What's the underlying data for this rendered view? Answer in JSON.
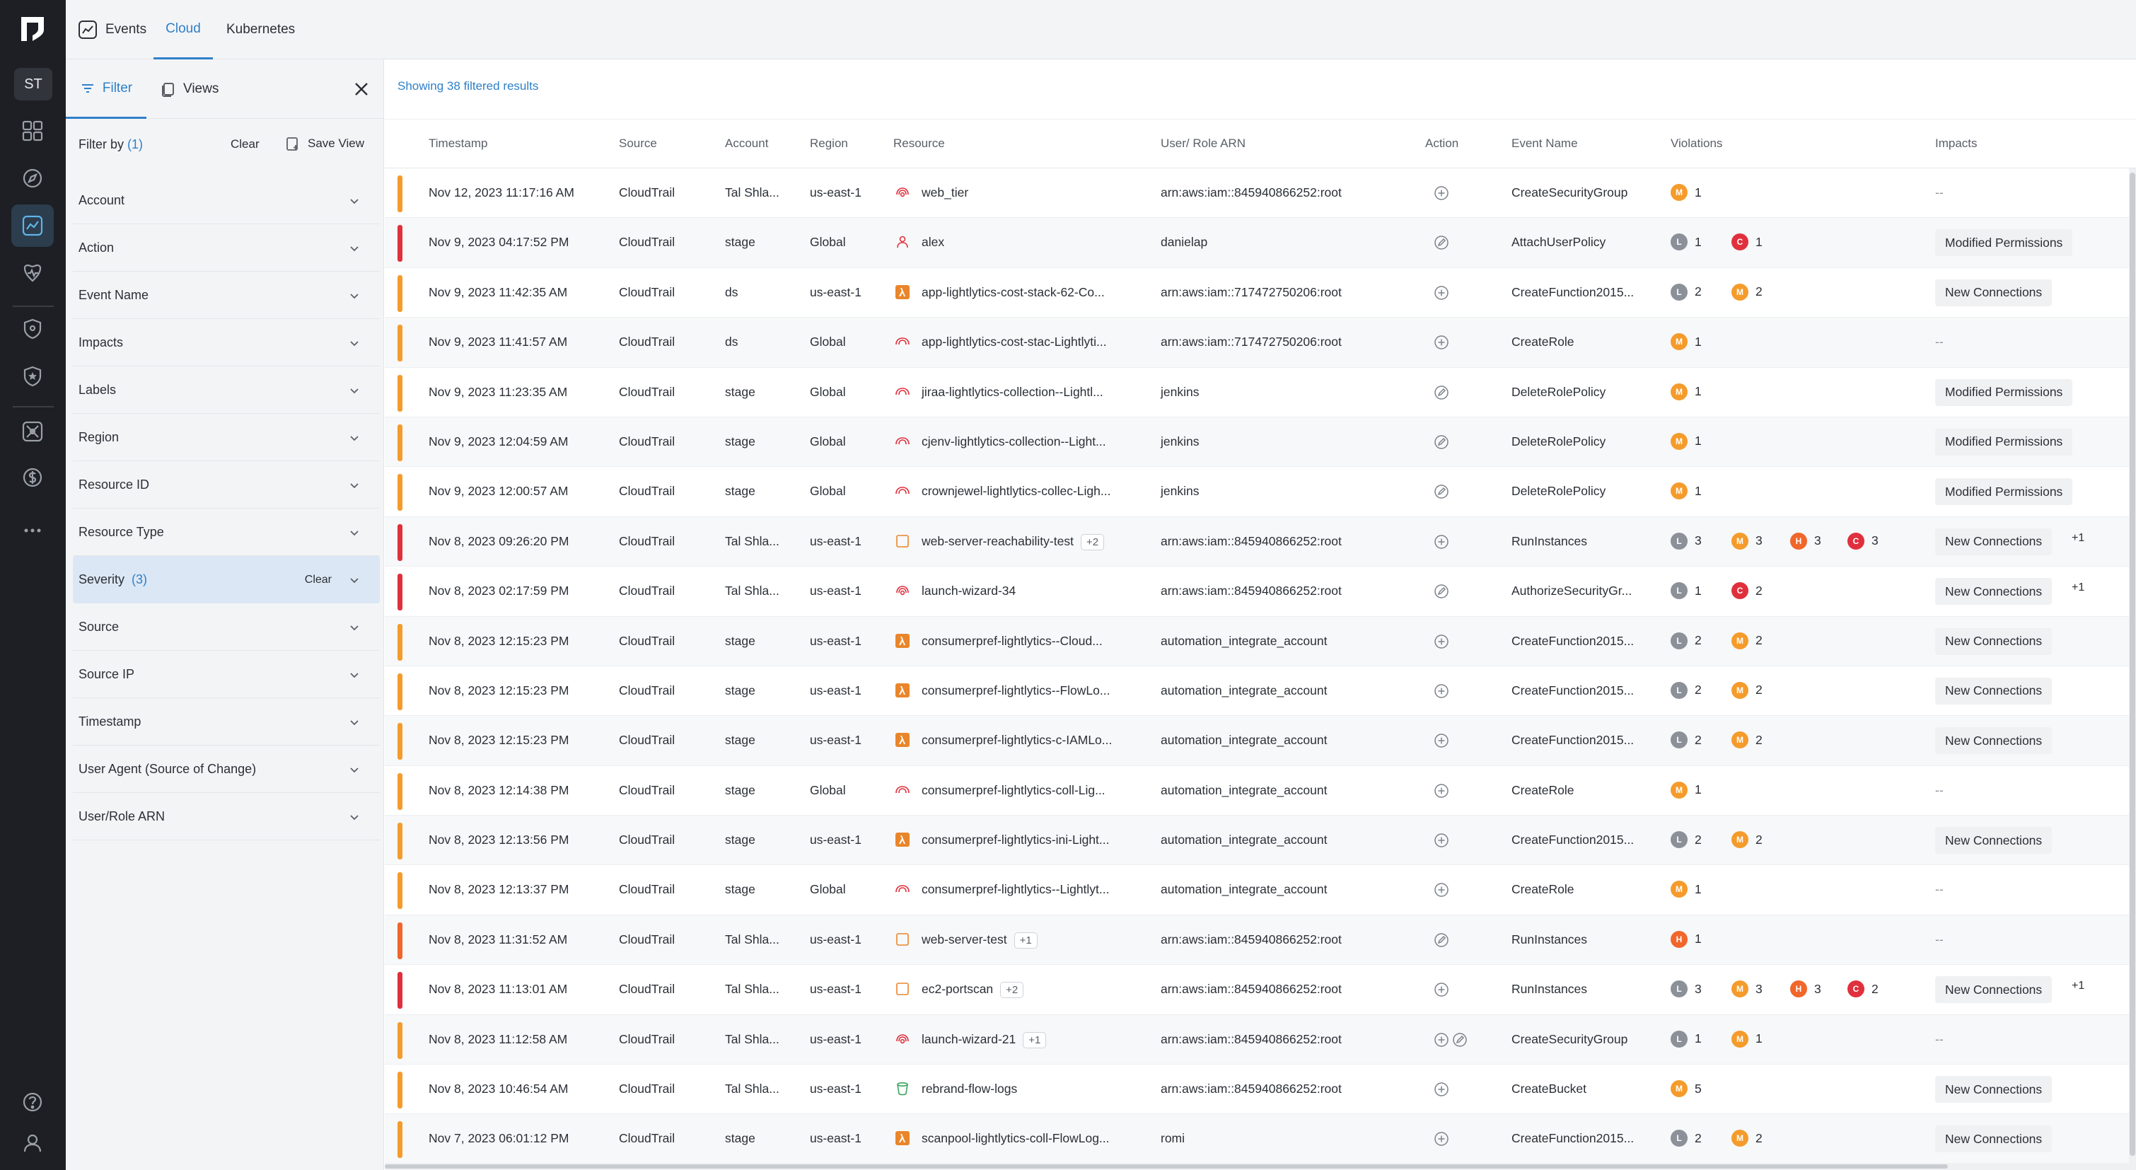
{
  "rail": {
    "avatar_initials": "ST",
    "icons": [
      "dashboard-icon",
      "compass-icon",
      "events-icon",
      "activity-icon",
      "shield-icon",
      "shield-star-icon",
      "graph-icon",
      "cost-icon",
      "more-icon",
      "help-icon",
      "user-icon"
    ],
    "active_icon": "events-icon"
  },
  "header": {
    "tabs": [
      {
        "label": "Events",
        "active": false
      },
      {
        "label": "Cloud",
        "active": true
      },
      {
        "label": "Kubernetes",
        "active": false
      }
    ]
  },
  "filter_panel": {
    "tab_filter": "Filter",
    "tab_views": "Views",
    "filter_by_label": "Filter by",
    "filter_by_count": "(1)",
    "clear_label": "Clear",
    "save_view_label": "Save View",
    "items": [
      {
        "label": "Account",
        "count": "",
        "active": false
      },
      {
        "label": "Action",
        "count": "",
        "active": false
      },
      {
        "label": "Event Name",
        "count": "",
        "active": false
      },
      {
        "label": "Impacts",
        "count": "",
        "active": false
      },
      {
        "label": "Labels",
        "count": "",
        "active": false
      },
      {
        "label": "Region",
        "count": "",
        "active": false
      },
      {
        "label": "Resource ID",
        "count": "",
        "active": false
      },
      {
        "label": "Resource Type",
        "count": "",
        "active": false
      },
      {
        "label": "Severity",
        "count": "(3)",
        "active": true,
        "clear": "Clear"
      },
      {
        "label": "Source",
        "count": "",
        "active": false
      },
      {
        "label": "Source IP",
        "count": "",
        "active": false
      },
      {
        "label": "Timestamp",
        "count": "",
        "active": false
      },
      {
        "label": "User Agent (Source of Change)",
        "count": "",
        "active": false
      },
      {
        "label": "User/Role ARN",
        "count": "",
        "active": false
      }
    ]
  },
  "table": {
    "results_text": "Showing 38 filtered results",
    "columns": [
      "Timestamp",
      "Source",
      "Account",
      "Region",
      "Resource",
      "User/ Role ARN",
      "Action",
      "Event Name",
      "Violations",
      "Impacts"
    ],
    "colors": {
      "critical": "#e0303d",
      "high": "#f0662b",
      "medium": "#f59b2b",
      "low": "#8b9099"
    },
    "rows": [
      {
        "sev": "medium",
        "ts": "Nov 12, 2023 11:17:16 AM",
        "source": "CloudTrail",
        "account": "Tal Shla...",
        "region": "us-east-1",
        "res_icon": "security-group-icon",
        "resource": "web_tier",
        "res_more": "",
        "arn": "arn:aws:iam::845940866252:root",
        "actions": [
          "plus-circle-icon"
        ],
        "event": "CreateSecurityGroup",
        "violations": [
          [
            "M",
            "1"
          ]
        ],
        "impact": "--",
        "imp_more": ""
      },
      {
        "sev": "critical",
        "ts": "Nov 9, 2023 04:17:52 PM",
        "source": "CloudTrail",
        "account": "stage",
        "region": "Global",
        "res_icon": "iam-user-icon",
        "resource": "alex",
        "res_more": "",
        "arn": "danielap",
        "actions": [
          "edit-circle-icon"
        ],
        "event": "AttachUserPolicy",
        "violations": [
          [
            "L",
            "1"
          ],
          [
            "C",
            "1"
          ]
        ],
        "impact": "Modified Permissions",
        "imp_more": ""
      },
      {
        "sev": "medium",
        "ts": "Nov 9, 2023 11:42:35 AM",
        "source": "CloudTrail",
        "account": "ds",
        "region": "us-east-1",
        "res_icon": "lambda-icon",
        "resource": "app-lightlytics-cost-stack-62-Co...",
        "res_more": "",
        "arn": "arn:aws:iam::717472750206:root",
        "actions": [
          "plus-circle-icon"
        ],
        "event": "CreateFunction2015...",
        "violations": [
          [
            "L",
            "2"
          ],
          [
            "M",
            "2"
          ]
        ],
        "impact": "New Connections",
        "imp_more": ""
      },
      {
        "sev": "medium",
        "ts": "Nov 9, 2023 11:41:57 AM",
        "source": "CloudTrail",
        "account": "ds",
        "region": "Global",
        "res_icon": "iam-role-icon",
        "resource": "app-lightlytics-cost-stac-Lightlyti...",
        "res_more": "",
        "arn": "arn:aws:iam::717472750206:root",
        "actions": [
          "plus-circle-icon"
        ],
        "event": "CreateRole",
        "violations": [
          [
            "M",
            "1"
          ]
        ],
        "impact": "--",
        "imp_more": ""
      },
      {
        "sev": "medium",
        "ts": "Nov 9, 2023 11:23:35 AM",
        "source": "CloudTrail",
        "account": "stage",
        "region": "Global",
        "res_icon": "iam-role-icon",
        "resource": "jiraa-lightlytics-collection--Lightl...",
        "res_more": "",
        "arn": "jenkins",
        "actions": [
          "edit-circle-icon"
        ],
        "event": "DeleteRolePolicy",
        "violations": [
          [
            "M",
            "1"
          ]
        ],
        "impact": "Modified Permissions",
        "imp_more": ""
      },
      {
        "sev": "medium",
        "ts": "Nov 9, 2023 12:04:59 AM",
        "source": "CloudTrail",
        "account": "stage",
        "region": "Global",
        "res_icon": "iam-role-icon",
        "resource": "cjenv-lightlytics-collection--Light...",
        "res_more": "",
        "arn": "jenkins",
        "actions": [
          "edit-circle-icon"
        ],
        "event": "DeleteRolePolicy",
        "violations": [
          [
            "M",
            "1"
          ]
        ],
        "impact": "Modified Permissions",
        "imp_more": ""
      },
      {
        "sev": "medium",
        "ts": "Nov 9, 2023 12:00:57 AM",
        "source": "CloudTrail",
        "account": "stage",
        "region": "Global",
        "res_icon": "iam-role-icon",
        "resource": "crownjewel-lightlytics-collec-Ligh...",
        "res_more": "",
        "arn": "jenkins",
        "actions": [
          "edit-circle-icon"
        ],
        "event": "DeleteRolePolicy",
        "violations": [
          [
            "M",
            "1"
          ]
        ],
        "impact": "Modified Permissions",
        "imp_more": ""
      },
      {
        "sev": "critical",
        "ts": "Nov 8, 2023 09:26:20 PM",
        "source": "CloudTrail",
        "account": "Tal Shla...",
        "region": "us-east-1",
        "res_icon": "ec2-instance-icon",
        "resource": "web-server-reachability-test",
        "res_more": "+2",
        "arn": "arn:aws:iam::845940866252:root",
        "actions": [
          "plus-circle-icon"
        ],
        "event": "RunInstances",
        "violations": [
          [
            "L",
            "3"
          ],
          [
            "M",
            "3"
          ],
          [
            "H",
            "3"
          ],
          [
            "C",
            "3"
          ]
        ],
        "impact": "New Connections",
        "imp_more": "+1"
      },
      {
        "sev": "critical",
        "ts": "Nov 8, 2023 02:17:59 PM",
        "source": "CloudTrail",
        "account": "Tal Shla...",
        "region": "us-east-1",
        "res_icon": "security-group-icon",
        "resource": "launch-wizard-34",
        "res_more": "",
        "arn": "arn:aws:iam::845940866252:root",
        "actions": [
          "edit-circle-icon"
        ],
        "event": "AuthorizeSecurityGr...",
        "violations": [
          [
            "L",
            "1"
          ],
          [
            "C",
            "2"
          ]
        ],
        "impact": "New Connections",
        "imp_more": "+1"
      },
      {
        "sev": "medium",
        "ts": "Nov 8, 2023 12:15:23 PM",
        "source": "CloudTrail",
        "account": "stage",
        "region": "us-east-1",
        "res_icon": "lambda-icon",
        "resource": "consumerpref-lightlytics--Cloud...",
        "res_more": "",
        "arn": "automation_integrate_account",
        "actions": [
          "plus-circle-icon"
        ],
        "event": "CreateFunction2015...",
        "violations": [
          [
            "L",
            "2"
          ],
          [
            "M",
            "2"
          ]
        ],
        "impact": "New Connections",
        "imp_more": ""
      },
      {
        "sev": "medium",
        "ts": "Nov 8, 2023 12:15:23 PM",
        "source": "CloudTrail",
        "account": "stage",
        "region": "us-east-1",
        "res_icon": "lambda-icon",
        "resource": "consumerpref-lightlytics--FlowLo...",
        "res_more": "",
        "arn": "automation_integrate_account",
        "actions": [
          "plus-circle-icon"
        ],
        "event": "CreateFunction2015...",
        "violations": [
          [
            "L",
            "2"
          ],
          [
            "M",
            "2"
          ]
        ],
        "impact": "New Connections",
        "imp_more": ""
      },
      {
        "sev": "medium",
        "ts": "Nov 8, 2023 12:15:23 PM",
        "source": "CloudTrail",
        "account": "stage",
        "region": "us-east-1",
        "res_icon": "lambda-icon",
        "resource": "consumerpref-lightlytics-c-IAMLo...",
        "res_more": "",
        "arn": "automation_integrate_account",
        "actions": [
          "plus-circle-icon"
        ],
        "event": "CreateFunction2015...",
        "violations": [
          [
            "L",
            "2"
          ],
          [
            "M",
            "2"
          ]
        ],
        "impact": "New Connections",
        "imp_more": ""
      },
      {
        "sev": "medium",
        "ts": "Nov 8, 2023 12:14:38 PM",
        "source": "CloudTrail",
        "account": "stage",
        "region": "Global",
        "res_icon": "iam-role-icon",
        "resource": "consumerpref-lightlytics-coll-Lig...",
        "res_more": "",
        "arn": "automation_integrate_account",
        "actions": [
          "plus-circle-icon"
        ],
        "event": "CreateRole",
        "violations": [
          [
            "M",
            "1"
          ]
        ],
        "impact": "--",
        "imp_more": ""
      },
      {
        "sev": "medium",
        "ts": "Nov 8, 2023 12:13:56 PM",
        "source": "CloudTrail",
        "account": "stage",
        "region": "us-east-1",
        "res_icon": "lambda-icon",
        "resource": "consumerpref-lightlytics-ini-Light...",
        "res_more": "",
        "arn": "automation_integrate_account",
        "actions": [
          "plus-circle-icon"
        ],
        "event": "CreateFunction2015...",
        "violations": [
          [
            "L",
            "2"
          ],
          [
            "M",
            "2"
          ]
        ],
        "impact": "New Connections",
        "imp_more": ""
      },
      {
        "sev": "medium",
        "ts": "Nov 8, 2023 12:13:37 PM",
        "source": "CloudTrail",
        "account": "stage",
        "region": "Global",
        "res_icon": "iam-role-icon",
        "resource": "consumerpref-lightlytics--Lightlyt...",
        "res_more": "",
        "arn": "automation_integrate_account",
        "actions": [
          "plus-circle-icon"
        ],
        "event": "CreateRole",
        "violations": [
          [
            "M",
            "1"
          ]
        ],
        "impact": "--",
        "imp_more": ""
      },
      {
        "sev": "high",
        "ts": "Nov 8, 2023 11:31:52 AM",
        "source": "CloudTrail",
        "account": "Tal Shla...",
        "region": "us-east-1",
        "res_icon": "ec2-instance-icon",
        "resource": "web-server-test",
        "res_more": "+1",
        "arn": "arn:aws:iam::845940866252:root",
        "actions": [
          "edit-circle-icon"
        ],
        "event": "RunInstances",
        "violations": [
          [
            "H",
            "1"
          ]
        ],
        "impact": "--",
        "imp_more": ""
      },
      {
        "sev": "critical",
        "ts": "Nov 8, 2023 11:13:01 AM",
        "source": "CloudTrail",
        "account": "Tal Shla...",
        "region": "us-east-1",
        "res_icon": "ec2-instance-icon",
        "resource": "ec2-portscan",
        "res_more": "+2",
        "arn": "arn:aws:iam::845940866252:root",
        "actions": [
          "plus-circle-icon"
        ],
        "event": "RunInstances",
        "violations": [
          [
            "L",
            "3"
          ],
          [
            "M",
            "3"
          ],
          [
            "H",
            "3"
          ],
          [
            "C",
            "2"
          ]
        ],
        "impact": "New Connections",
        "imp_more": "+1"
      },
      {
        "sev": "medium",
        "ts": "Nov 8, 2023 11:12:58 AM",
        "source": "CloudTrail",
        "account": "Tal Shla...",
        "region": "us-east-1",
        "res_icon": "security-group-icon",
        "resource": "launch-wizard-21",
        "res_more": "+1",
        "arn": "arn:aws:iam::845940866252:root",
        "actions": [
          "plus-circle-icon",
          "edit-circle-icon"
        ],
        "event": "CreateSecurityGroup",
        "violations": [
          [
            "L",
            "1"
          ],
          [
            "M",
            "1"
          ]
        ],
        "impact": "--",
        "imp_more": ""
      },
      {
        "sev": "medium",
        "ts": "Nov 8, 2023 10:46:54 AM",
        "source": "CloudTrail",
        "account": "Tal Shla...",
        "region": "us-east-1",
        "res_icon": "s3-bucket-icon",
        "resource": "rebrand-flow-logs",
        "res_more": "",
        "arn": "arn:aws:iam::845940866252:root",
        "actions": [
          "plus-circle-icon"
        ],
        "event": "CreateBucket",
        "violations": [
          [
            "M",
            "5"
          ]
        ],
        "impact": "New Connections",
        "imp_more": ""
      },
      {
        "sev": "medium",
        "ts": "Nov 7, 2023 06:01:12 PM",
        "source": "CloudTrail",
        "account": "stage",
        "region": "us-east-1",
        "res_icon": "lambda-icon",
        "resource": "scanpool-lightlytics-coll-FlowLog...",
        "res_more": "",
        "arn": "romi",
        "actions": [
          "plus-circle-icon"
        ],
        "event": "CreateFunction2015...",
        "violations": [
          [
            "L",
            "2"
          ],
          [
            "M",
            "2"
          ]
        ],
        "impact": "New Connections",
        "imp_more": ""
      }
    ]
  }
}
